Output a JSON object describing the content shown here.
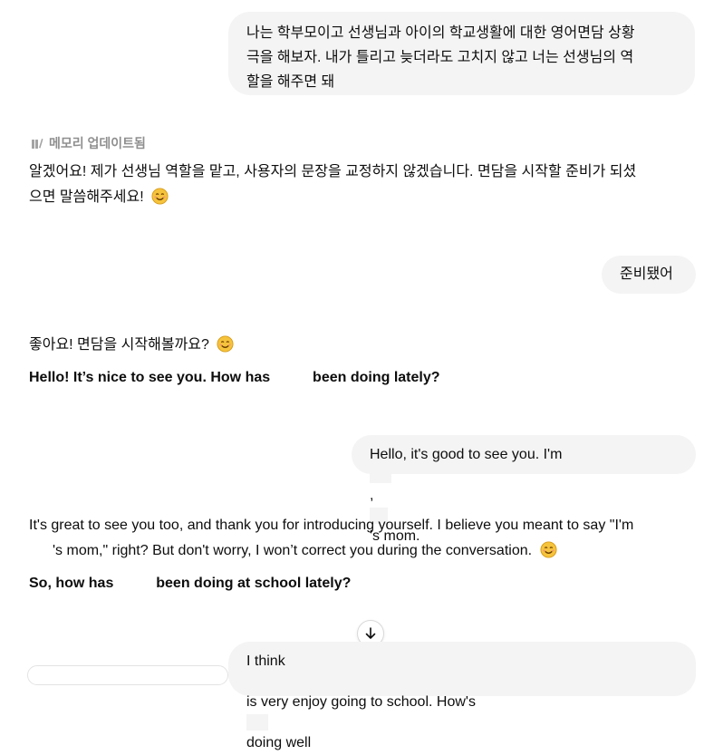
{
  "messages": {
    "user_1": {
      "line1": "나는 학부모이고 선생님과 아이의 학교생활에 대한 영어면담 상황",
      "line2": "극을 해보자. 내가 틀리고 늦더라도 고치지 않고 너는 선생님의 역",
      "line3": "할을 해주면 돼"
    },
    "memory_updated": "메모리 업데이트됨",
    "assistant_1": {
      "line1": "알겠어요! 제가 선생님 역할을 맡고, 사용자의 문장을 교정하지 않겠습니다. 면담을 시작할 준비가 되셨",
      "line2": "으면 말씀해주세요!"
    },
    "user_2": "준비됐어",
    "assistant_2": {
      "line1": "좋아요! 면담을 시작해볼까요?",
      "line2a": "Hello! It’s nice to see you. How has",
      "line2b": "been doing lately?"
    },
    "user_3": {
      "a": "Hello, it's good to see you. I'm",
      "b": ",",
      "c": "'s mom."
    },
    "assistant_3": {
      "line1": "It's great to see you too, and thank you for introducing yourself. I believe you meant to say \"I'm",
      "line2": "'s mom,\" right? But don't worry, I won’t correct you during the conversation.",
      "line3a": "So, how has",
      "line3b": "been doing at school lately?"
    },
    "user_4": {
      "a": "I think",
      "b": "is very enjoy going to school. How's",
      "c": "doing well"
    }
  },
  "icons": {
    "memory": "memory-update-icon",
    "emoji": "smiling-face-emoji",
    "scroll": "arrow-down-icon"
  },
  "colors": {
    "user_bubble": "#f4f4f4",
    "meta_text": "#8f8f8f",
    "emoji_yellow": "#f6c43c"
  }
}
